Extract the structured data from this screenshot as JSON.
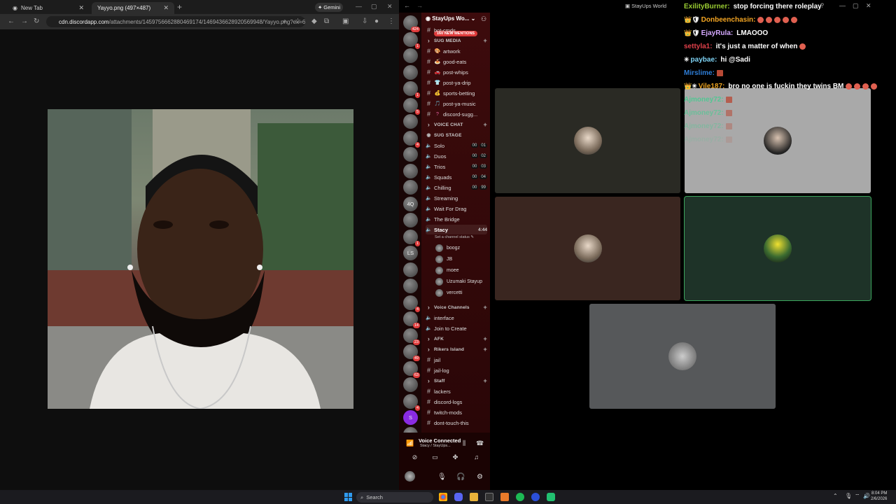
{
  "browser": {
    "tabs": [
      {
        "title": "New Tab",
        "active": false
      },
      {
        "title": "Yayyo.png (497×487)",
        "active": true
      }
    ],
    "gemini_label": "Gemini",
    "url_host": "cdn.discordapp.com",
    "url_path": "/attachments/1459756662880469174/1469436628920569948/Yayyo.png?ex=6..."
  },
  "discord": {
    "window_title": "StayUps World",
    "server_name": "StayUps Wo...",
    "mentions_badge": "160 NEW MENTIONS",
    "server_icons": [
      {
        "label": "",
        "badge": "424"
      },
      {
        "label": "",
        "badge": "1"
      },
      {
        "label": "",
        "badge": ""
      },
      {
        "label": "",
        "badge": ""
      },
      {
        "label": "",
        "badge": "1"
      },
      {
        "label": "",
        "badge": "5"
      },
      {
        "label": "",
        "badge": ""
      },
      {
        "label": "",
        "badge": "4"
      },
      {
        "label": "",
        "badge": ""
      },
      {
        "label": "",
        "badge": ""
      },
      {
        "label": "",
        "badge": ""
      },
      {
        "label": "4Q",
        "badge": ""
      },
      {
        "label": "",
        "badge": ""
      },
      {
        "label": "",
        "badge": "1"
      },
      {
        "label": "LS",
        "badge": ""
      },
      {
        "label": "",
        "badge": ""
      },
      {
        "label": "",
        "badge": ""
      },
      {
        "label": "",
        "badge": "4"
      },
      {
        "label": "",
        "badge": "14"
      },
      {
        "label": "",
        "badge": "23"
      },
      {
        "label": "",
        "badge": "49"
      },
      {
        "label": "",
        "badge": "63"
      },
      {
        "label": "",
        "badge": ""
      },
      {
        "label": "",
        "badge": "4"
      },
      {
        "label": "S",
        "badge": ""
      },
      {
        "label": "",
        "badge": "160"
      },
      {
        "label": "",
        "badge": "32"
      },
      {
        "label": "NEW",
        "badge": ""
      }
    ],
    "channels": [
      {
        "type": "text",
        "emoji": "",
        "name": "bot-cmds"
      },
      {
        "type": "header",
        "name": "SUG MEDIA"
      },
      {
        "type": "text",
        "emoji": "🎨",
        "name": "artwork"
      },
      {
        "type": "text",
        "emoji": "🍝",
        "name": "good-eats"
      },
      {
        "type": "text",
        "emoji": "🚗",
        "name": "post-whips"
      },
      {
        "type": "text",
        "emoji": "👕",
        "name": "post-ya-drip"
      },
      {
        "type": "text",
        "emoji": "💰",
        "name": "sports-betting"
      },
      {
        "type": "text",
        "emoji": "🎵",
        "name": "post-ya-music"
      },
      {
        "type": "text",
        "emoji": "?",
        "name": "discord-sugg..."
      },
      {
        "type": "header",
        "name": "VOICE CHAT"
      },
      {
        "type": "stage",
        "name": "SUG STAGE"
      },
      {
        "type": "voice",
        "name": "Solo",
        "a": "00",
        "b": "01"
      },
      {
        "type": "voice",
        "name": "Duos",
        "a": "00",
        "b": "02"
      },
      {
        "type": "voice",
        "name": "Trios",
        "a": "00",
        "b": "03"
      },
      {
        "type": "voice",
        "name": "Squads",
        "a": "00",
        "b": "04"
      },
      {
        "type": "voice",
        "name": "Chilling",
        "a": "00",
        "b": "99"
      },
      {
        "type": "voice",
        "name": "Streaming"
      },
      {
        "type": "voice",
        "name": "Wait For Drag"
      },
      {
        "type": "voice",
        "name": "The Bridge"
      },
      {
        "type": "voice-active",
        "name": "Stacy",
        "time": "4:44"
      }
    ],
    "channel_status": "Set a channel status",
    "voice_users": [
      "boogz",
      "JB",
      "moee",
      "Uzumaki Stayup",
      "vercetti"
    ],
    "channels_bottom": [
      {
        "type": "header",
        "name": "Voice Channels"
      },
      {
        "type": "voice",
        "name": "interface"
      },
      {
        "type": "voice",
        "name": "Join to Create"
      },
      {
        "type": "header",
        "name": "AFK"
      },
      {
        "type": "header",
        "name": "Rikers Island"
      },
      {
        "type": "text",
        "name": "jail"
      },
      {
        "type": "text",
        "name": "jail-log"
      },
      {
        "type": "header",
        "name": "Staff"
      },
      {
        "type": "text",
        "name": "lackers"
      },
      {
        "type": "text",
        "name": "discord-logs"
      },
      {
        "type": "text",
        "name": "twitch-mods"
      },
      {
        "type": "text",
        "name": "dont-touch-this"
      }
    ],
    "voice_connected": "Voice Connected",
    "voice_location": "Stacy / StayUps...",
    "tiles": [
      {
        "bg": "#2a2a24"
      },
      {
        "bg": "#a9a9a9"
      },
      {
        "bg": "#3a2620"
      },
      {
        "bg": "#1e3328"
      },
      {
        "bg": "#56585a"
      }
    ]
  },
  "chat": [
    {
      "user": "ExilityBurner:",
      "color": "#9acd32",
      "text": "stop forcing there roleplay",
      "icons": "",
      "emotes": 0
    },
    {
      "user": "Donbeenchasin:",
      "color": "#f5a623",
      "text": "",
      "icons": "👑🛡",
      "emotes": 5
    },
    {
      "user": "EjayRula:",
      "color": "#d4a8ff",
      "text": "LMAOOO",
      "icons": "👑🛡",
      "emotes": 0
    },
    {
      "user": "settyla1:",
      "color": "#e0404a",
      "text": "it's just a matter of when",
      "icons": "",
      "emotes": 1
    },
    {
      "user": "paybae:",
      "color": "#7ed3f5",
      "text": "hi @Sadi",
      "icons": "✳",
      "emotes": 0
    },
    {
      "user": "Mirslime:",
      "color": "#2e7dd6",
      "text": "",
      "icons": "",
      "emotes": 1
    },
    {
      "user": "Vile187:",
      "color": "#e8a020",
      "text": "bro no one is fuckin they twins BM",
      "icons": "👑✳",
      "emotes": 4
    },
    {
      "user": "Ajmoney72:",
      "color": "#3ccf8e",
      "text": "",
      "icons": "",
      "emotes": 1
    },
    {
      "user": "Ajmoney72:",
      "color": "#3ccf8e",
      "text": "",
      "icons": "",
      "emotes": 1
    },
    {
      "user": "Ajmoney72:",
      "color": "#3ccf8e",
      "text": "",
      "icons": "",
      "emotes": 1
    },
    {
      "user": "Ajmoney72:",
      "color": "#3ccf8e",
      "text": "",
      "icons": "",
      "emotes": 1
    }
  ],
  "taskbar": {
    "search_placeholder": "Search",
    "time": "8:04 PM",
    "date": "2/6/2026"
  }
}
